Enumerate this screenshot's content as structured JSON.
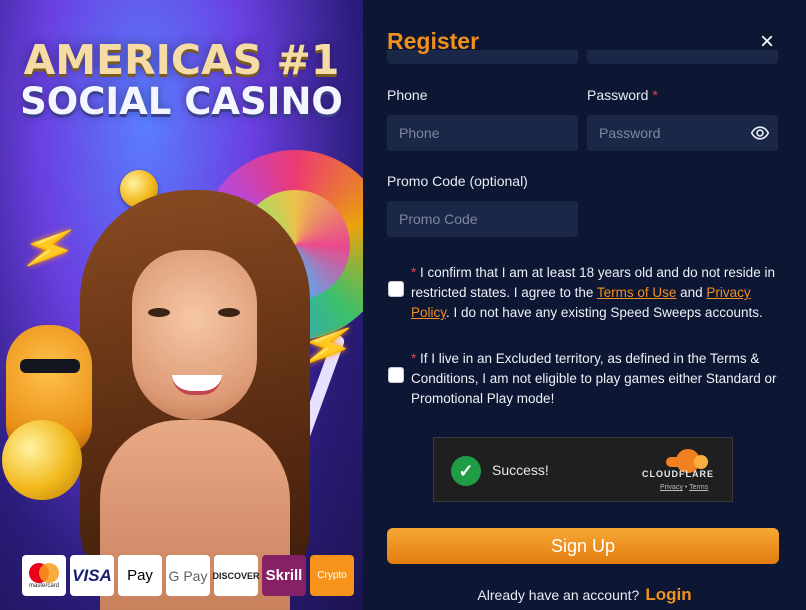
{
  "promo": {
    "headline_line1": "AMERICAS #1",
    "headline_line2": "SOCIAL CASINO",
    "payments": {
      "mastercard": "mastercard",
      "visa": "VISA",
      "applepay": " Pay",
      "googlepay": "G Pay",
      "discover": "DISCOVER",
      "skrill": "Skrill",
      "crypto": "Crypto"
    }
  },
  "form": {
    "title": "Register",
    "close_icon": "×",
    "phone": {
      "label": "Phone",
      "placeholder": "Phone",
      "value": ""
    },
    "password": {
      "label": "Password",
      "required_mark": "*",
      "placeholder": "Password",
      "value": ""
    },
    "promo_code": {
      "label": "Promo Code (optional)",
      "placeholder": "Promo Code",
      "value": ""
    },
    "consent1": {
      "required_mark": "*",
      "text_before": " I confirm that I am at least 18 years old and do not reside in restricted states. I agree to the ",
      "terms_link": "Terms of Use",
      "and": " and ",
      "privacy_link": "Privacy Policy",
      "text_after": ". I do not have any existing Speed Sweeps accounts."
    },
    "consent2": {
      "required_mark": "*",
      "text": " If I live in an Excluded territory, as defined in the Terms & Conditions, I am not eligible to play games either Standard or Promotional Play mode!"
    },
    "captcha": {
      "status": "Success!",
      "brand": "CLOUDFLARE",
      "privacy": "Privacy",
      "separator": " • ",
      "terms": "Terms"
    },
    "signup_label": "Sign Up",
    "already_text": "Already have an account?",
    "login_label": "Login"
  },
  "colors": {
    "accent": "#f0901e",
    "panel_bg": "#0d1633",
    "input_bg": "#1b2747",
    "required": "#e24a4a",
    "success": "#1f9d45"
  },
  "icons": {
    "close": "close-icon",
    "eye": "eye-icon",
    "check": "checkmark-icon",
    "cloudflare": "cloudflare-logo-icon"
  }
}
